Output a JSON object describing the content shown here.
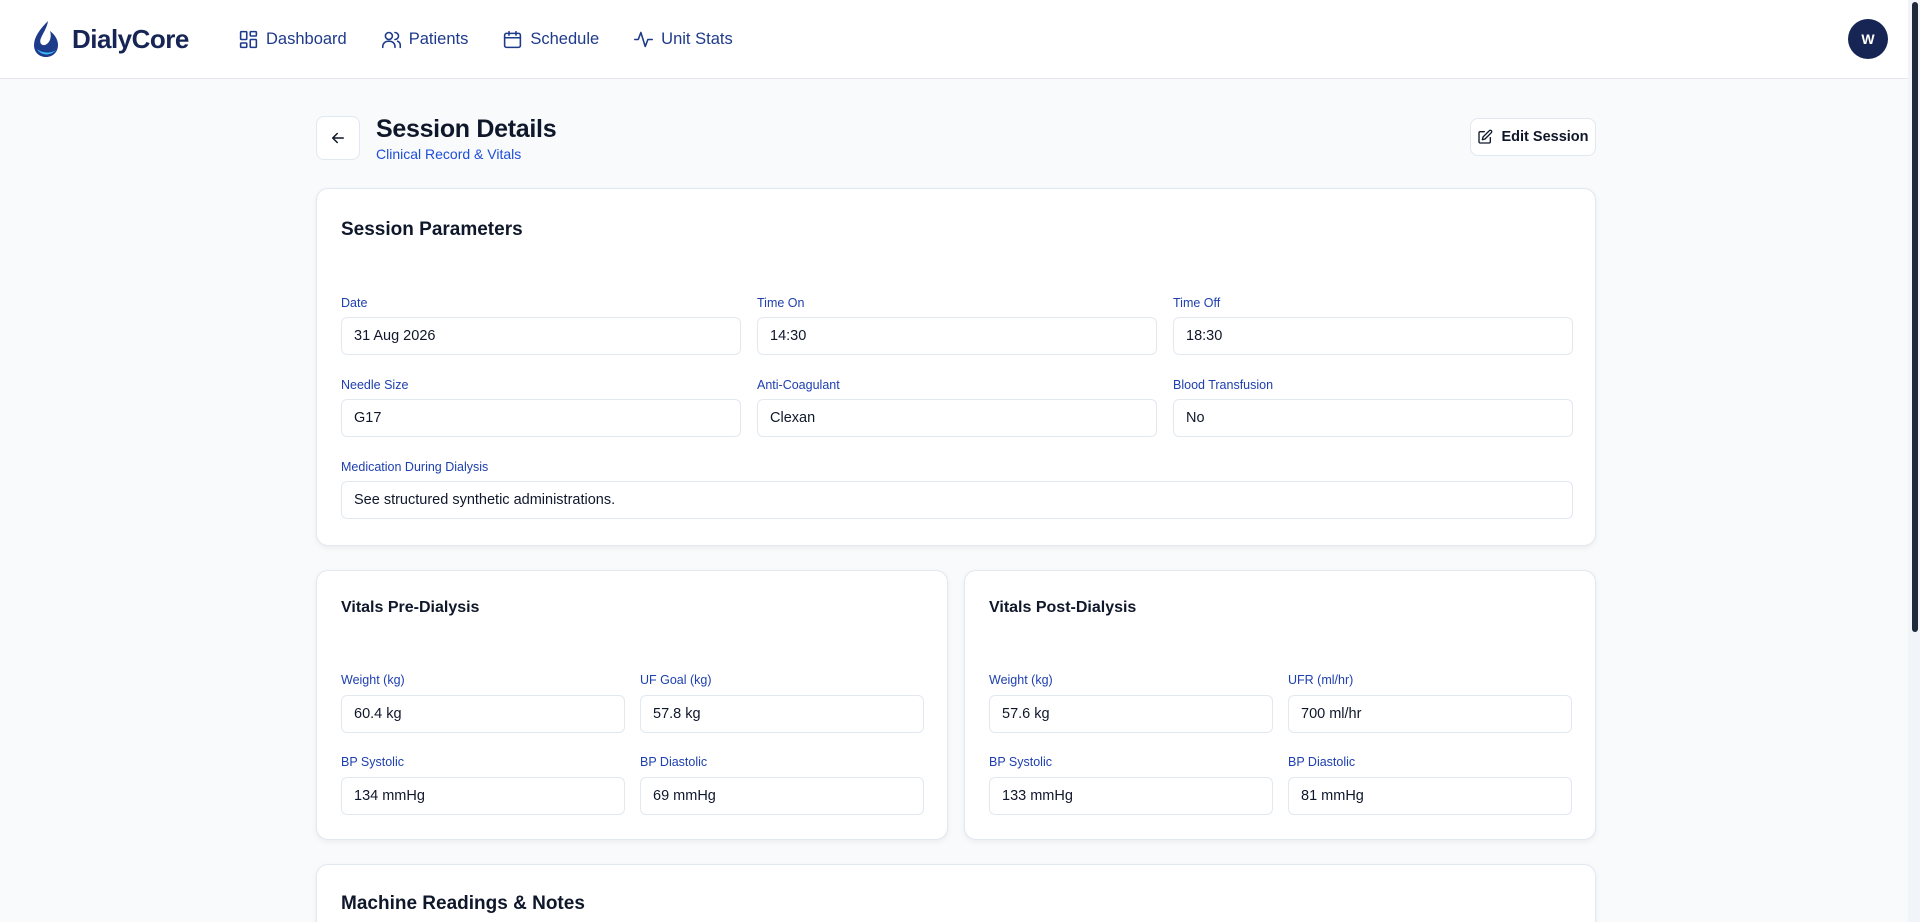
{
  "app": {
    "name": "DialyCore",
    "avatar_initial": "W"
  },
  "nav": [
    {
      "label": "Dashboard",
      "icon": "dashboard-icon"
    },
    {
      "label": "Patients",
      "icon": "users-icon"
    },
    {
      "label": "Schedule",
      "icon": "calendar-icon"
    },
    {
      "label": "Unit Stats",
      "icon": "activity-icon"
    }
  ],
  "header": {
    "title": "Session Details",
    "subtitle": "Clinical Record & Vitals",
    "edit_label": "Edit Session"
  },
  "session_parameters": {
    "title": "Session Parameters",
    "fields": [
      {
        "label": "Date",
        "value": "31 Aug 2026"
      },
      {
        "label": "Time On",
        "value": "14:30"
      },
      {
        "label": "Time Off",
        "value": "18:30"
      },
      {
        "label": "Needle Size",
        "value": "G17"
      },
      {
        "label": "Anti-Coagulant",
        "value": "Clexan"
      },
      {
        "label": "Blood Transfusion",
        "value": "No"
      }
    ],
    "medication": {
      "label": "Medication During Dialysis",
      "value": "See structured synthetic administrations."
    }
  },
  "vitals_pre": {
    "title": "Vitals Pre-Dialysis",
    "fields": [
      {
        "label": "Weight (kg)",
        "value": "60.4 kg"
      },
      {
        "label": "UF Goal (kg)",
        "value": "57.8 kg"
      },
      {
        "label": "BP Systolic",
        "value": "134 mmHg"
      },
      {
        "label": "BP Diastolic",
        "value": "69 mmHg"
      }
    ]
  },
  "vitals_post": {
    "title": "Vitals Post-Dialysis",
    "fields": [
      {
        "label": "Weight (kg)",
        "value": "57.6 kg"
      },
      {
        "label": "UFR (ml/hr)",
        "value": "700 ml/hr"
      },
      {
        "label": "BP Systolic",
        "value": "133 mmHg"
      },
      {
        "label": "BP Diastolic",
        "value": "81 mmHg"
      }
    ]
  },
  "machine": {
    "title": "Machine Readings & Notes"
  },
  "colors": {
    "primary": "#172554",
    "accent": "#1d4ed8",
    "border": "#e2e8f0"
  }
}
